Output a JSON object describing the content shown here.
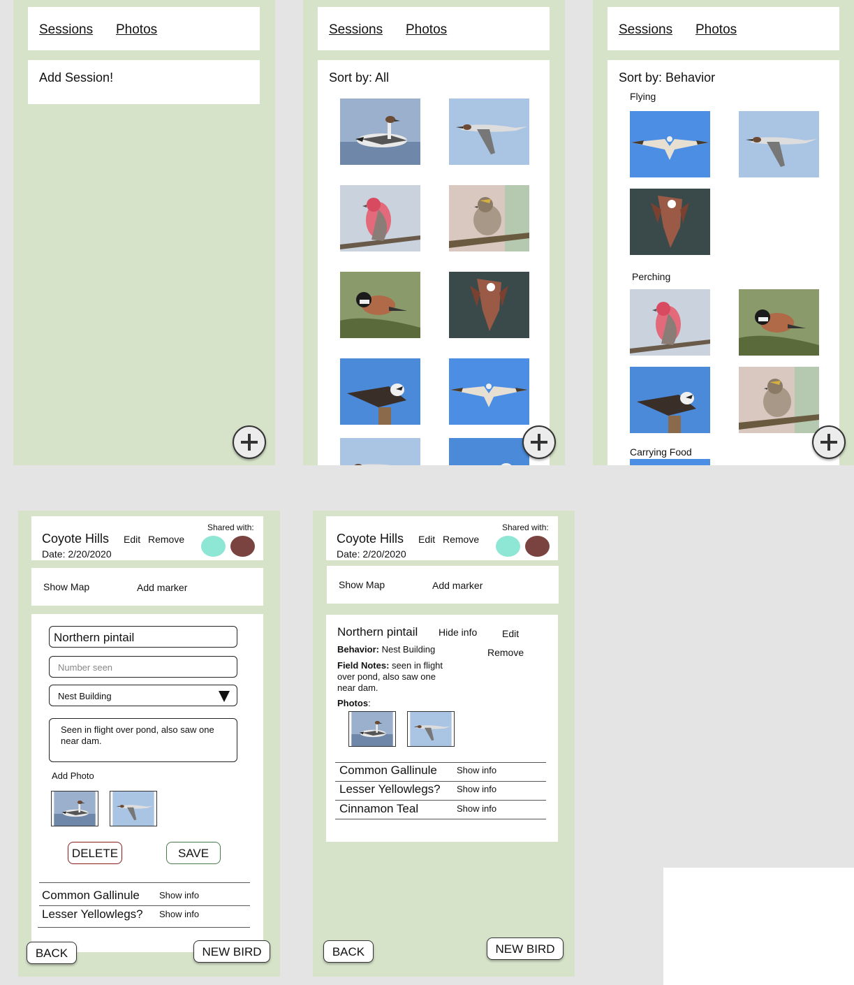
{
  "colors": {
    "screen_bg": "#d6e3c9",
    "card": "#ffffff",
    "avatar1": "#8ee6d4",
    "avatar2": "#7b4340",
    "delete": "#8b1a1a"
  },
  "nav": {
    "sessions": "Sessions",
    "photos": "Photos"
  },
  "screen1": {
    "add_session": "Add Session!"
  },
  "screen2": {
    "sort_label": "Sort by: All"
  },
  "screen3": {
    "sort_label": "Sort by: Behavior",
    "groups": [
      "Flying",
      "Perching",
      "Carrying Food"
    ]
  },
  "session": {
    "title": "Coyote Hills",
    "date": "Date: 2/20/2020",
    "edit": "Edit",
    "remove": "Remove",
    "shared_with": "Shared with:",
    "show_map": "Show Map",
    "add_marker": "Add marker"
  },
  "form": {
    "species_value": "Northern pintail",
    "number_placeholder": "Number seen",
    "behavior_value": "Nest Building",
    "notes_value": "Seen in flight over pond, also saw one near dam.",
    "add_photo": "Add Photo",
    "delete": "DELETE",
    "save": "SAVE"
  },
  "detail": {
    "species": "Northern pintail",
    "hide_info": "Hide info",
    "edit": "Edit",
    "remove": "Remove",
    "behavior_label": "Behavior:",
    "behavior_value": " Nest Building",
    "notes_label": "Field Notes:",
    "notes_value": " seen in flight over pond, also saw one near dam.",
    "photos_label": "Photos",
    "photos_colon": ":"
  },
  "bird_list_a": [
    {
      "name": "Common Gallinule",
      "action": "Show info"
    },
    {
      "name": "Lesser Yellowlegs?",
      "action": "Show info"
    }
  ],
  "bird_list_b": [
    {
      "name": "Common Gallinule",
      "action": "Show info"
    },
    {
      "name": "Lesser Yellowlegs?",
      "action": "Show info"
    },
    {
      "name": "Cinnamon Teal",
      "action": "Show info"
    }
  ],
  "footer": {
    "back": "BACK",
    "new_bird": "NEW BIRD"
  },
  "icons": [
    "add-icon",
    "dropdown-arrow-icon"
  ]
}
